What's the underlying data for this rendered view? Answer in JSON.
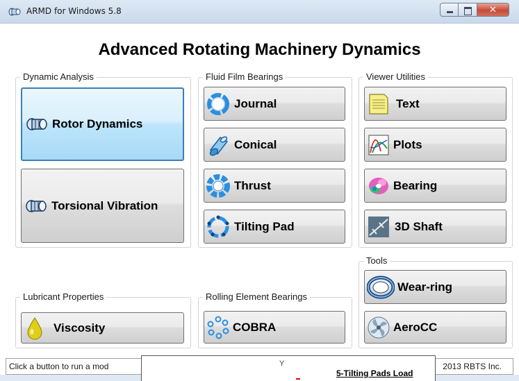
{
  "window": {
    "title": "ARMD for Windows 5.8"
  },
  "heading": "Advanced Rotating Machinery Dynamics",
  "groups": {
    "dynamic_analysis": {
      "label": "Dynamic Analysis",
      "buttons": [
        {
          "label": "Rotor Dynamics",
          "icon": "rotor-icon",
          "focused": true
        },
        {
          "label": "Torsional Vibration",
          "icon": "rotor-icon",
          "focused": false
        }
      ]
    },
    "fluid_film": {
      "label": "Fluid Film Bearings",
      "buttons": [
        {
          "label": "Journal",
          "icon": "journal-bearing-icon"
        },
        {
          "label": "Conical",
          "icon": "conical-bearing-icon"
        },
        {
          "label": "Thrust",
          "icon": "thrust-bearing-icon"
        },
        {
          "label": "Tilting Pad",
          "icon": "tilting-pad-icon"
        }
      ]
    },
    "viewer": {
      "label": "Viewer Utilities",
      "buttons": [
        {
          "label": "Text",
          "icon": "text-file-icon"
        },
        {
          "label": "Plots",
          "icon": "plot-icon"
        },
        {
          "label": "Bearing",
          "icon": "bearing-view-icon"
        },
        {
          "label": "3D Shaft",
          "icon": "shaft-3d-icon"
        }
      ]
    },
    "tools": {
      "label": "Tools",
      "buttons": [
        {
          "label": "Wear-ring",
          "icon": "wear-ring-icon"
        },
        {
          "label": "AeroCC",
          "icon": "fan-icon"
        }
      ]
    },
    "lubricant": {
      "label": "Lubricant Properties",
      "buttons": [
        {
          "label": "Viscosity",
          "icon": "oil-drop-icon"
        }
      ]
    },
    "rolling": {
      "label": "Rolling Element Bearings",
      "buttons": [
        {
          "label": "COBRA",
          "icon": "ball-bearing-icon"
        }
      ]
    }
  },
  "status": {
    "text": "Click a button to run a mod",
    "copyright": "2013 RBTS Inc."
  },
  "preview": {
    "axis": "Y",
    "title": "5-Tilting Pads Load"
  },
  "colors": {
    "focus_border": "#3c7fb1",
    "icon_blue": "#2a7fd0",
    "close_red": "#c74a38"
  }
}
